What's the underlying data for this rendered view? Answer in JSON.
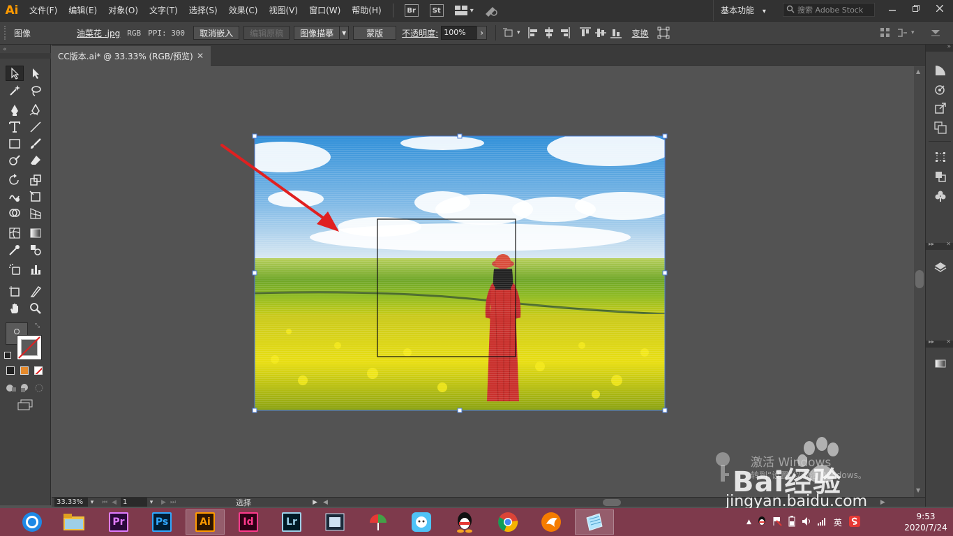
{
  "app": {
    "logo": "Ai",
    "menus": [
      "文件(F)",
      "编辑(E)",
      "对象(O)",
      "文字(T)",
      "选择(S)",
      "效果(C)",
      "视图(V)",
      "窗口(W)",
      "帮助(H)"
    ],
    "bridge_label": "Br",
    "stock_label": "St",
    "workspace": "基本功能",
    "stock_search_placeholder": "搜索 Adobe Stock"
  },
  "controlbar": {
    "mode_label": "图像",
    "file_name": "油菜花 .jpg",
    "color_mode": "RGB",
    "ppi": "PPI: 300",
    "unembed_button": "取消嵌入",
    "edit_original_button": "编辑原稿",
    "image_trace_button": "图像描摹",
    "mask_button": "蒙版",
    "opacity_label": "不透明度:",
    "opacity_value": "100%",
    "transform_label": "变换"
  },
  "document": {
    "tab_title": "CC版本.ai* @ 33.33% (RGB/预览)",
    "zoom": "33.33%",
    "artboard_number": "1",
    "status": "选择"
  },
  "taskbar": {
    "apps": [
      "Pr",
      "Ps",
      "Ai",
      "Id",
      "Lr"
    ],
    "ime": "英",
    "time": "9:53",
    "date": "2020/7/24"
  },
  "watermark": {
    "activate_line1": "激活 Windows",
    "activate_line2": "转到“设置”以激活 Windows。",
    "brand": "Bai经验",
    "url": "jingyan.baidu.com"
  },
  "colors": {
    "menubar_bg": "#323232",
    "panel_bg": "#424242",
    "canvas_bg": "#535353",
    "taskbar_bg": "#7e3a4c",
    "selection_blue": "#4a7bd6",
    "arrow_red": "#e02020"
  }
}
